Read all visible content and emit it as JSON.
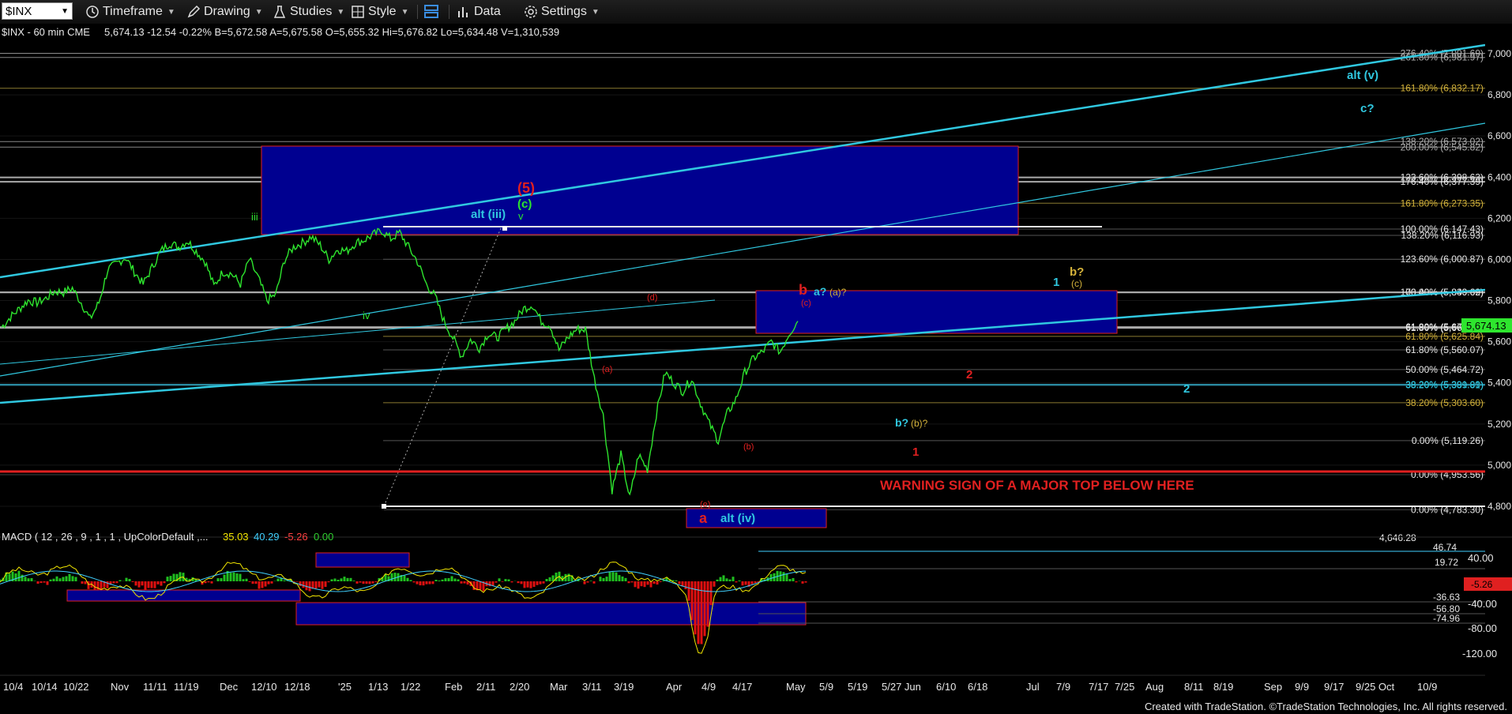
{
  "toolbar": {
    "symbol": "$INX",
    "items": [
      "Timeframe",
      "Drawing",
      "Studies",
      "Style",
      "Data",
      "Settings"
    ]
  },
  "header": {
    "symbol_label": "$INX - 60 min CME",
    "quote": "5,674.13 -12.54 -0.22% B=5,672.58 A=5,675.58 O=5,655.32 Hi=5,676.82 Lo=5,634.48 V=1,310,539"
  },
  "macd": {
    "label": "MACD ( 12 , 26 , 9 , 1 , 1 , UpColorDefault ,...",
    "values": [
      "35.03",
      "40.29",
      "-5.26",
      "0.00"
    ],
    "value_colors": [
      "#f2e600",
      "#3fd0ff",
      "#ff4040",
      "#30d030"
    ],
    "right_labels": [
      "46.74",
      "19.72",
      "-36.63",
      "-56.80",
      "-74.96"
    ],
    "axis_labels": [
      "40.00",
      "-40.00",
      "-80.00",
      "-120.00"
    ],
    "last_value": "-5.26"
  },
  "footer": "Created with TradeStation. ©TradeStation Technologies, Inc. All rights reserved.",
  "colors": {
    "price": "#2ee52e",
    "cyan": "#30c8e0",
    "red": "#e02020",
    "box": "#000090",
    "gold": "#d4b23a"
  },
  "chart_data": {
    "type": "line",
    "title": "$INX - 60 min CME",
    "last_price": 5674.13,
    "last_price_label": "5,674.13",
    "y_range": [
      4620,
      7060
    ],
    "y_ticks": [
      "7,000.00",
      "6,800.00",
      "6,600.00",
      "6,400.00",
      "6,200.00",
      "6,000.00",
      "5,800.00",
      "5,600.00",
      "5,400.00",
      "5,200.00",
      "5,000.00",
      "4,800.00"
    ],
    "x_tick_labels": [
      "10/4",
      "10/14",
      "10/22",
      "Nov",
      "11/11",
      "11/19",
      "Dec",
      "12/10",
      "12/18",
      "'25",
      "1/13",
      "1/22",
      "Feb",
      "2/11",
      "2/20",
      "Mar",
      "3/11",
      "3/19",
      "Apr",
      "4/9",
      "4/17",
      "May",
      "5/9",
      "5/19",
      "5/27 Jun",
      "6/10",
      "6/18",
      "Jul",
      "7/9",
      "7/17",
      "7/25",
      "Aug",
      "8/11",
      "8/19",
      "Sep",
      "9/9",
      "9/17",
      "9/25 Oct",
      "10/9"
    ],
    "price_series": [
      [
        0,
        5670
      ],
      [
        0.5,
        5720
      ],
      [
        1,
        5760
      ],
      [
        1.5,
        5800
      ],
      [
        2,
        5790
      ],
      [
        2.5,
        5810
      ],
      [
        3,
        5845
      ],
      [
        3.5,
        5840
      ],
      [
        4,
        5860
      ],
      [
        4.5,
        5790
      ],
      [
        5,
        5710
      ],
      [
        5.5,
        5790
      ],
      [
        6,
        5950
      ],
      [
        6.5,
        5980
      ],
      [
        7,
        6010
      ],
      [
        7.5,
        5940
      ],
      [
        8,
        5880
      ],
      [
        8.5,
        5960
      ],
      [
        9,
        6040
      ],
      [
        9.5,
        6080
      ],
      [
        10,
        6060
      ],
      [
        10.5,
        6090
      ],
      [
        11,
        6040
      ],
      [
        11.5,
        5990
      ],
      [
        12,
        5870
      ],
      [
        12.5,
        5940
      ],
      [
        13,
        5930
      ],
      [
        13.5,
        5880
      ],
      [
        14,
        6000
      ],
      [
        14.5,
        5910
      ],
      [
        15,
        5800
      ],
      [
        15.5,
        5830
      ],
      [
        16,
        6000
      ],
      [
        16.5,
        6060
      ],
      [
        17,
        6080
      ],
      [
        17.5,
        6110
      ],
      [
        18,
        6070
      ],
      [
        18.5,
        6000
      ],
      [
        19,
        6050
      ],
      [
        19.5,
        6040
      ],
      [
        20,
        6080
      ],
      [
        20.5,
        6095
      ],
      [
        21,
        6120
      ],
      [
        21.5,
        6140
      ],
      [
        22,
        6100
      ],
      [
        22.5,
        6130
      ],
      [
        23,
        6060
      ],
      [
        23.5,
        5990
      ],
      [
        24,
        5880
      ],
      [
        24.5,
        5820
      ],
      [
        25,
        5700
      ],
      [
        25.5,
        5620
      ],
      [
        26,
        5530
      ],
      [
        26.5,
        5610
      ],
      [
        27,
        5570
      ],
      [
        27.5,
        5640
      ],
      [
        28,
        5620
      ],
      [
        28.5,
        5660
      ],
      [
        29,
        5700
      ],
      [
        29.5,
        5760
      ],
      [
        30,
        5780
      ],
      [
        30.5,
        5700
      ],
      [
        31,
        5680
      ],
      [
        31.5,
        5560
      ],
      [
        32,
        5620
      ],
      [
        32.5,
        5660
      ],
      [
        33,
        5660
      ],
      [
        33.5,
        5420
      ],
      [
        34,
        5240
      ],
      [
        34.5,
        4880
      ],
      [
        35,
        5050
      ],
      [
        35.5,
        4840
      ],
      [
        36,
        5050
      ],
      [
        36.5,
        4980
      ],
      [
        37,
        5250
      ],
      [
        37.5,
        5450
      ],
      [
        38,
        5400
      ],
      [
        38.5,
        5360
      ],
      [
        39,
        5420
      ],
      [
        39.5,
        5300
      ],
      [
        40,
        5200
      ],
      [
        40.5,
        5120
      ],
      [
        41,
        5250
      ],
      [
        41.5,
        5320
      ],
      [
        42,
        5450
      ],
      [
        42.5,
        5520
      ],
      [
        43,
        5550
      ],
      [
        43.5,
        5600
      ],
      [
        44,
        5550
      ],
      [
        44.5,
        5640
      ],
      [
        45,
        5700
      ]
    ],
    "fib_levels": [
      {
        "label": "276.40% (7,001.69)",
        "value": 7001.69
      },
      {
        "label": "261.80% (6,981.97)",
        "value": 6981.97
      },
      {
        "label": "161.80% (6,832.17)",
        "value": 6832.17
      },
      {
        "label": "138.20% (6,573.02)",
        "value": 6573.02
      },
      {
        "label": "200.00% (6,545.82)",
        "value": 6545.82
      },
      {
        "label": "123.60% (6,398.63)",
        "value": 6398.63
      },
      {
        "label": "176.40% (6,377.39)",
        "value": 6377.39
      },
      {
        "label": "161.80% (6,273.35)",
        "value": 6273.35
      },
      {
        "label": "100.00% (6,147.43)",
        "value": 6147.43
      },
      {
        "label": "138.20% (6,116.93)",
        "value": 6116.93
      },
      {
        "label": "123.60% (6,000.87)",
        "value": 6000.87
      },
      {
        "label": "76.40% (5,840.62)",
        "value": 5840.62
      },
      {
        "label": "100.00% (5,839.69)",
        "value": 5839.69
      },
      {
        "label": "61.80% (5,671.10)",
        "value": 5671.1
      },
      {
        "label": "61.80% (5,667.19)",
        "value": 5667.19
      },
      {
        "label": "61.80% (5,625.84)",
        "value": 5625.84
      },
      {
        "label": "61.80% (5,560.07)",
        "value": 5560.07
      },
      {
        "label": "50.00% (5,464.72)",
        "value": 5464.72
      },
      {
        "label": "38.20% (5,391.09)",
        "value": 5391.09
      },
      {
        "label": "38.20% (5,389.81)",
        "value": 5389.81
      },
      {
        "label": "38.20% (5,303.60)",
        "value": 5303.6
      },
      {
        "label": "0.00% (5,119.26)",
        "value": 5119.26
      },
      {
        "label": "0.00% (4,953.56)",
        "value": 4953.56
      },
      {
        "label": "0.00% (4,783.30)",
        "value": 4783.3
      }
    ],
    "low_label": "4,646.28",
    "annotations": [
      {
        "text": "alt (v)",
        "color": "cyan"
      },
      {
        "text": "c?",
        "color": "cyan"
      },
      {
        "text": "(5)",
        "color": "red"
      },
      {
        "text": "(c)",
        "color": "green"
      },
      {
        "text": "v",
        "color": "green"
      },
      {
        "text": "alt (iii)",
        "color": "cyan"
      },
      {
        "text": "iii",
        "color": "green"
      },
      {
        "text": "iv",
        "color": "green"
      },
      {
        "text": "(d)",
        "color": "red"
      },
      {
        "text": "(a)",
        "color": "red"
      },
      {
        "text": "(e)",
        "color": "red"
      },
      {
        "text": "(b)",
        "color": "red"
      },
      {
        "text": "(c)",
        "color": "red"
      },
      {
        "text": "a",
        "color": "red"
      },
      {
        "text": "b",
        "color": "red"
      },
      {
        "text": "a?",
        "color": "cyan"
      },
      {
        "text": "(a)?",
        "color": "gold"
      },
      {
        "text": "1",
        "color": "cyan"
      },
      {
        "text": "b?",
        "color": "gold"
      },
      {
        "text": "(c)",
        "color": "gold"
      },
      {
        "text": "2",
        "color": "red"
      },
      {
        "text": "2",
        "color": "cyan"
      },
      {
        "text": "b?",
        "color": "cyan"
      },
      {
        "text": "(b)?",
        "color": "gold"
      },
      {
        "text": "1",
        "color": "red"
      },
      {
        "text": "alt (iv)",
        "color": "cyan"
      },
      {
        "text": "WARNING SIGN OF A MAJOR TOP BELOW HERE",
        "color": "red"
      }
    ]
  }
}
